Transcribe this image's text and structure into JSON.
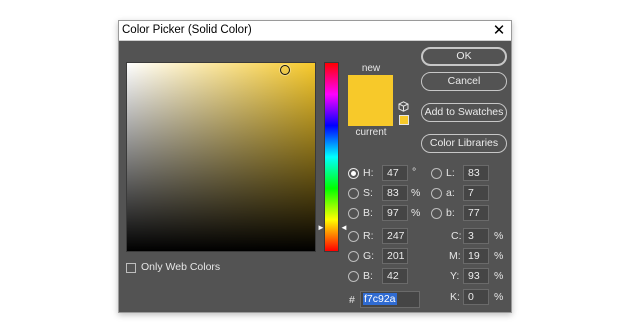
{
  "window": {
    "title": "Color Picker (Solid Color)",
    "close_glyph": "✕"
  },
  "colors": {
    "new": "#f7c92a",
    "current": "#f7c92a",
    "hue_base": "#f7c92a"
  },
  "swatch_labels": {
    "new": "new",
    "current": "current"
  },
  "buttons": {
    "ok": "OK",
    "cancel": "Cancel",
    "add_to_swatches": "Add to Swatches",
    "color_libraries": "Color Libraries"
  },
  "hsb": {
    "h": {
      "label": "H:",
      "value": "47",
      "unit": "°"
    },
    "s": {
      "label": "S:",
      "value": "83",
      "unit": "%"
    },
    "b": {
      "label": "B:",
      "value": "97",
      "unit": "%"
    }
  },
  "rgb": {
    "r": {
      "label": "R:",
      "value": "247"
    },
    "g": {
      "label": "G:",
      "value": "201"
    },
    "b": {
      "label": "B:",
      "value": "42"
    }
  },
  "lab": {
    "l": {
      "label": "L:",
      "value": "83"
    },
    "a": {
      "label": "a:",
      "value": "7"
    },
    "b": {
      "label": "b:",
      "value": "77"
    }
  },
  "cmyk": {
    "c": {
      "label": "C:",
      "value": "3",
      "unit": "%"
    },
    "m": {
      "label": "M:",
      "value": "19",
      "unit": "%"
    },
    "y": {
      "label": "Y:",
      "value": "93",
      "unit": "%"
    },
    "k": {
      "label": "K:",
      "value": "0",
      "unit": "%"
    }
  },
  "hex": {
    "prefix": "#",
    "value": "f7c92a"
  },
  "only_web_colors": {
    "label": "Only Web Colors",
    "checked": false
  },
  "selected_mode": "H",
  "icons": {
    "cube": "cube-icon",
    "close": "close-icon"
  }
}
